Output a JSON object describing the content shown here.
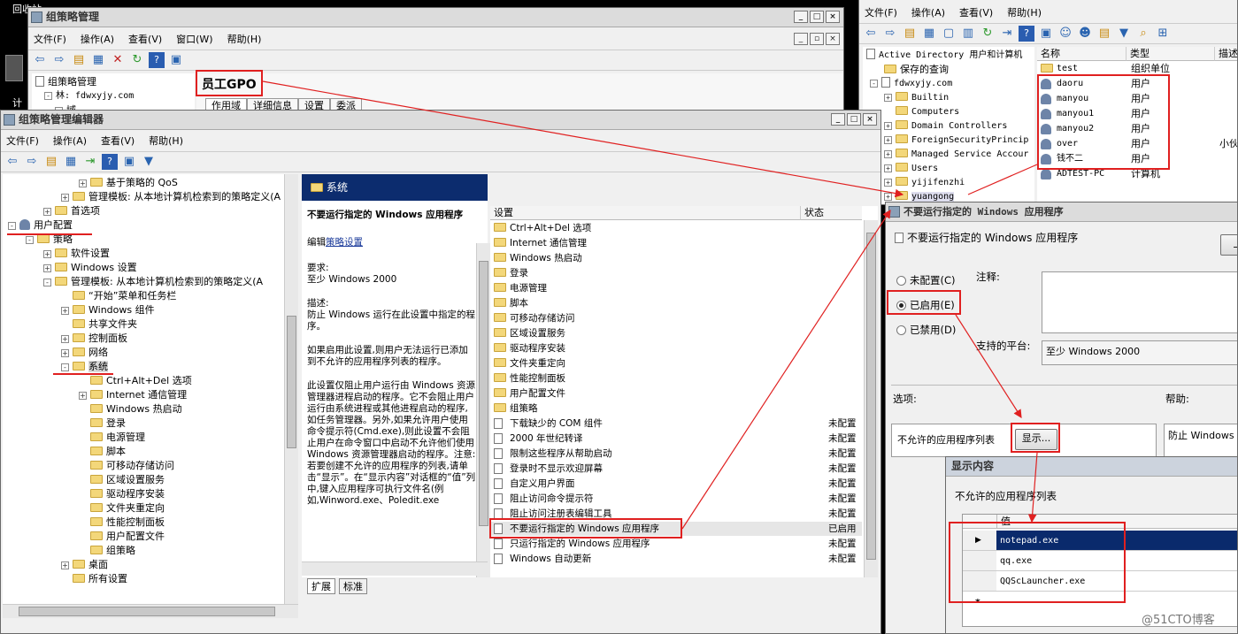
{
  "desktop": {
    "label1": "回收站",
    "label2": "计"
  },
  "gpm": {
    "title": "组策略管理",
    "menu": [
      "文件(F)",
      "操作(A)",
      "查看(V)",
      "窗口(W)",
      "帮助(H)"
    ],
    "tree": [
      "组策略管理",
      "林: fdwxyjy.com",
      "域"
    ],
    "gpo_name": "员工GPO",
    "tabs": [
      "作用域",
      "详细信息",
      "设置",
      "委派"
    ]
  },
  "aduc": {
    "menu": [
      "文件(F)",
      "操作(A)",
      "查看(V)",
      "帮助(H)"
    ],
    "tree": [
      "Active Directory 用户和计算机",
      "保存的查询",
      "fdwxyjy.com",
      "Builtin",
      "Computers",
      "Domain Controllers",
      "ForeignSecurityPrincip",
      "Managed Service Accour",
      "Users",
      "yijifenzhi",
      "yuangong"
    ],
    "col_name": "名称",
    "col_type": "类型",
    "col_desc": "描述",
    "rows": [
      {
        "name": "test",
        "type": "组织单位",
        "desc": ""
      },
      {
        "name": "daoru",
        "type": "用户",
        "desc": ""
      },
      {
        "name": "manyou",
        "type": "用户",
        "desc": ""
      },
      {
        "name": "manyou1",
        "type": "用户",
        "desc": ""
      },
      {
        "name": "manyou2",
        "type": "用户",
        "desc": ""
      },
      {
        "name": "over",
        "type": "用户",
        "desc": "小伙"
      },
      {
        "name": "钱不二",
        "type": "用户",
        "desc": ""
      },
      {
        "name": "ADTEST-PC",
        "type": "计算机",
        "desc": ""
      }
    ]
  },
  "editor": {
    "title": "组策略管理编辑器",
    "menu": [
      "文件(F)",
      "操作(A)",
      "查看(V)",
      "帮助(H)"
    ],
    "tree": [
      {
        "label": "基于策略的 QoS",
        "indent": 4,
        "exp": "+"
      },
      {
        "label": "管理模板: 从本地计算机检索到的策略定义(A",
        "indent": 3,
        "exp": "+"
      },
      {
        "label": "首选项",
        "indent": 2,
        "exp": "+"
      },
      {
        "label": "用户配置",
        "indent": 0,
        "exp": "-"
      },
      {
        "label": "策略",
        "indent": 1,
        "exp": "-"
      },
      {
        "label": "软件设置",
        "indent": 2,
        "exp": "+"
      },
      {
        "label": "Windows 设置",
        "indent": 2,
        "exp": "+"
      },
      {
        "label": "管理模板: 从本地计算机检索到的策略定义(A",
        "indent": 2,
        "exp": "-"
      },
      {
        "label": "“开始”菜单和任务栏",
        "indent": 3,
        "exp": ""
      },
      {
        "label": "Windows 组件",
        "indent": 3,
        "exp": "+"
      },
      {
        "label": "共享文件夹",
        "indent": 3,
        "exp": ""
      },
      {
        "label": "控制面板",
        "indent": 3,
        "exp": "+"
      },
      {
        "label": "网络",
        "indent": 3,
        "exp": "+"
      },
      {
        "label": "系统",
        "indent": 3,
        "exp": "-"
      },
      {
        "label": "Ctrl+Alt+Del 选项",
        "indent": 4,
        "exp": ""
      },
      {
        "label": "Internet 通信管理",
        "indent": 4,
        "exp": "+"
      },
      {
        "label": "Windows 热启动",
        "indent": 4,
        "exp": ""
      },
      {
        "label": "登录",
        "indent": 4,
        "exp": ""
      },
      {
        "label": "电源管理",
        "indent": 4,
        "exp": ""
      },
      {
        "label": "脚本",
        "indent": 4,
        "exp": ""
      },
      {
        "label": "可移动存储访问",
        "indent": 4,
        "exp": ""
      },
      {
        "label": "区域设置服务",
        "indent": 4,
        "exp": ""
      },
      {
        "label": "驱动程序安装",
        "indent": 4,
        "exp": ""
      },
      {
        "label": "文件夹重定向",
        "indent": 4,
        "exp": ""
      },
      {
        "label": "性能控制面板",
        "indent": 4,
        "exp": ""
      },
      {
        "label": "用户配置文件",
        "indent": 4,
        "exp": ""
      },
      {
        "label": "组策略",
        "indent": 4,
        "exp": ""
      },
      {
        "label": "桌面",
        "indent": 3,
        "exp": "+"
      },
      {
        "label": "所有设置",
        "indent": 3,
        "exp": ""
      }
    ],
    "desc_header": "系统",
    "desc_title": "不要运行指定的 Windows 应用程序",
    "desc_edit_prefix": "编辑",
    "desc_edit_link": "策略设置",
    "desc_req_label": "要求:",
    "desc_req_value": "至少 Windows 2000",
    "desc_label": "描述:",
    "desc_text": "防止 Windows 运行在此设置中指定的程序。",
    "desc_p2": "如果启用此设置,则用户无法运行已添加到不允许的应用程序列表的程序。",
    "desc_p3": "此设置仅阻止用户运行由 Windows 资源管理器进程启动的程序。它不会阻止用户运行由系统进程或其他进程启动的程序,如任务管理器。另外,如果允许用户使用命令提示符(Cmd.exe),则此设置不会阻止用户在命令窗口中启动不允许他们使用 Windows 资源管理器启动的程序。注意: 若要创建不允许的应用程序的列表,请单击“显示”。在“显示内容”对话框的“值”列中,键入应用程序可执行文件名(例如,Winword.exe、Poledit.exe",
    "settings_col": "设置",
    "state_col": "状态",
    "settings": [
      {
        "label": "Ctrl+Alt+Del 选项",
        "state": "",
        "kind": "folder"
      },
      {
        "label": "Internet 通信管理",
        "state": "",
        "kind": "folder"
      },
      {
        "label": "Windows 热启动",
        "state": "",
        "kind": "folder"
      },
      {
        "label": "登录",
        "state": "",
        "kind": "folder"
      },
      {
        "label": "电源管理",
        "state": "",
        "kind": "folder"
      },
      {
        "label": "脚本",
        "state": "",
        "kind": "folder"
      },
      {
        "label": "可移动存储访问",
        "state": "",
        "kind": "folder"
      },
      {
        "label": "区域设置服务",
        "state": "",
        "kind": "folder"
      },
      {
        "label": "驱动程序安装",
        "state": "",
        "kind": "folder"
      },
      {
        "label": "文件夹重定向",
        "state": "",
        "kind": "folder"
      },
      {
        "label": "性能控制面板",
        "state": "",
        "kind": "folder"
      },
      {
        "label": "用户配置文件",
        "state": "",
        "kind": "folder"
      },
      {
        "label": "组策略",
        "state": "",
        "kind": "folder"
      },
      {
        "label": "下载缺少的 COM 组件",
        "state": "未配置",
        "kind": "doc"
      },
      {
        "label": "2000 年世纪转译",
        "state": "未配置",
        "kind": "doc"
      },
      {
        "label": "限制这些程序从帮助启动",
        "state": "未配置",
        "kind": "doc"
      },
      {
        "label": "登录时不显示欢迎屏幕",
        "state": "未配置",
        "kind": "doc"
      },
      {
        "label": "自定义用户界面",
        "state": "未配置",
        "kind": "doc"
      },
      {
        "label": "阻止访问命令提示符",
        "state": "未配置",
        "kind": "doc"
      },
      {
        "label": "阻止访问注册表编辑工具",
        "state": "未配置",
        "kind": "doc"
      },
      {
        "label": "不要运行指定的 Windows 应用程序",
        "state": "已启用",
        "kind": "doc"
      },
      {
        "label": "只运行指定的 Windows 应用程序",
        "state": "未配置",
        "kind": "doc"
      },
      {
        "label": "Windows 自动更新",
        "state": "未配置",
        "kind": "doc"
      }
    ],
    "tab_ext": "扩展",
    "tab_std": "标准"
  },
  "policy": {
    "title": "不要运行指定的 Windows 应用程序",
    "subtitle": "不要运行指定的 Windows 应用程序",
    "prev_btn": "上",
    "not_configured": "未配置(C)",
    "enabled": "已启用(E)",
    "disabled": "已禁用(D)",
    "comment_label": "注释:",
    "platform_label": "支持的平台:",
    "platform_value": "至少 Windows 2000",
    "options_label": "选项:",
    "help_label": "帮助:",
    "list_label": "不允许的应用程序列表",
    "show_btn": "显示...",
    "help_text": "防止 Windows"
  },
  "show": {
    "title": "显示内容",
    "label": "不允许的应用程序列表",
    "col": "值",
    "values": [
      "notepad.exe",
      "qq.exe",
      "QQScLauncher.exe"
    ],
    "new_marker": "*"
  },
  "watermark": "@51CTO博客"
}
